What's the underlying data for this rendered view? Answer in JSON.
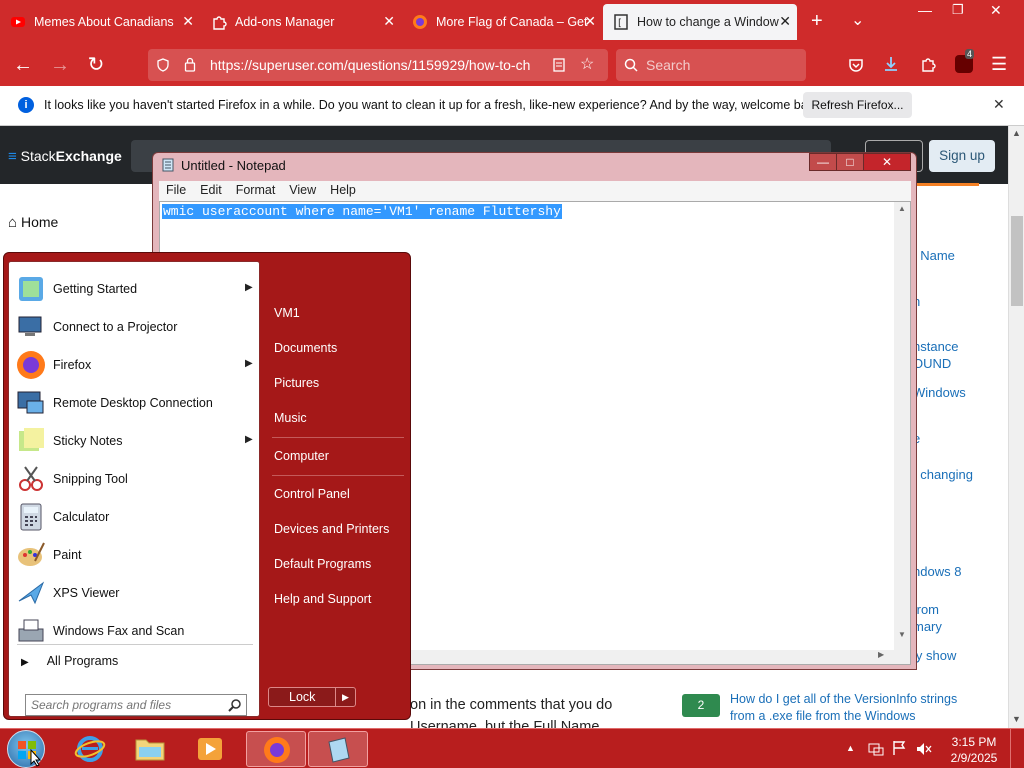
{
  "browser": {
    "tabs": [
      {
        "title": "Memes About Canadians",
        "close": "✕"
      },
      {
        "title": "Add-ons Manager",
        "close": "✕"
      },
      {
        "title": "More Flag of Canada – Get",
        "close": "✕"
      },
      {
        "title": "How to change a Window",
        "close": "✕"
      }
    ],
    "new_tab": "+",
    "tab_list": "⌄",
    "window_controls": {
      "minimize": "—",
      "maximize": "❐",
      "close": "✕"
    },
    "url": "https://superuser.com/questions/1159929/how-to-ch",
    "search_placeholder": "Search",
    "extension_badge": "4"
  },
  "notification": {
    "message": "It looks like you haven't started Firefox in a while. Do you want to clean it up for a fresh, like-new experience? And by the way, welcome back!",
    "button": "Refresh Firefox...",
    "close": "✕"
  },
  "site": {
    "logo_a": "Stack",
    "logo_b": "Exchange",
    "signup": "Sign up",
    "home": "Home",
    "right_fragments": [
      "t Name",
      "n",
      "nstance",
      "OUND",
      "Windows",
      "e",
      "t changing",
      "ndows 8",
      "from",
      "mary",
      "ly show"
    ],
    "bottom_text_1": "on in the comments that you do",
    "bottom_text_2": "Username, but the Full Name",
    "related_count": "2",
    "related_question": "How do I get all of the VersionInfo strings",
    "related_question_2": "from a .exe file from the Windows"
  },
  "notepad": {
    "title": "Untitled - Notepad",
    "menu": [
      "File",
      "Edit",
      "Format",
      "View",
      "Help"
    ],
    "content": "wmic useraccount where name='VM1' rename Fluttershy",
    "controls": {
      "minimize": "—",
      "maximize": "□",
      "close": "✕"
    }
  },
  "start_menu": {
    "programs": [
      {
        "label": "Getting Started",
        "arrow": "▶"
      },
      {
        "label": "Connect to a Projector",
        "arrow": ""
      },
      {
        "label": "Firefox",
        "arrow": "▶"
      },
      {
        "label": "Remote Desktop Connection",
        "arrow": ""
      },
      {
        "label": "Sticky Notes",
        "arrow": "▶"
      },
      {
        "label": "Snipping Tool",
        "arrow": ""
      },
      {
        "label": "Calculator",
        "arrow": ""
      },
      {
        "label": "Paint",
        "arrow": ""
      },
      {
        "label": "XPS Viewer",
        "arrow": ""
      },
      {
        "label": "Windows Fax and Scan",
        "arrow": ""
      }
    ],
    "all_programs": "All Programs",
    "search_placeholder": "Search programs and files",
    "right_items": [
      "VM1",
      "Documents",
      "Pictures",
      "Music",
      "Computer",
      "Control Panel",
      "Devices and Printers",
      "Default Programs",
      "Help and Support"
    ],
    "lock": "Lock",
    "lock_arrow": "▶"
  },
  "taskbar": {
    "time": "3:15 PM",
    "date": "2/9/2025"
  }
}
